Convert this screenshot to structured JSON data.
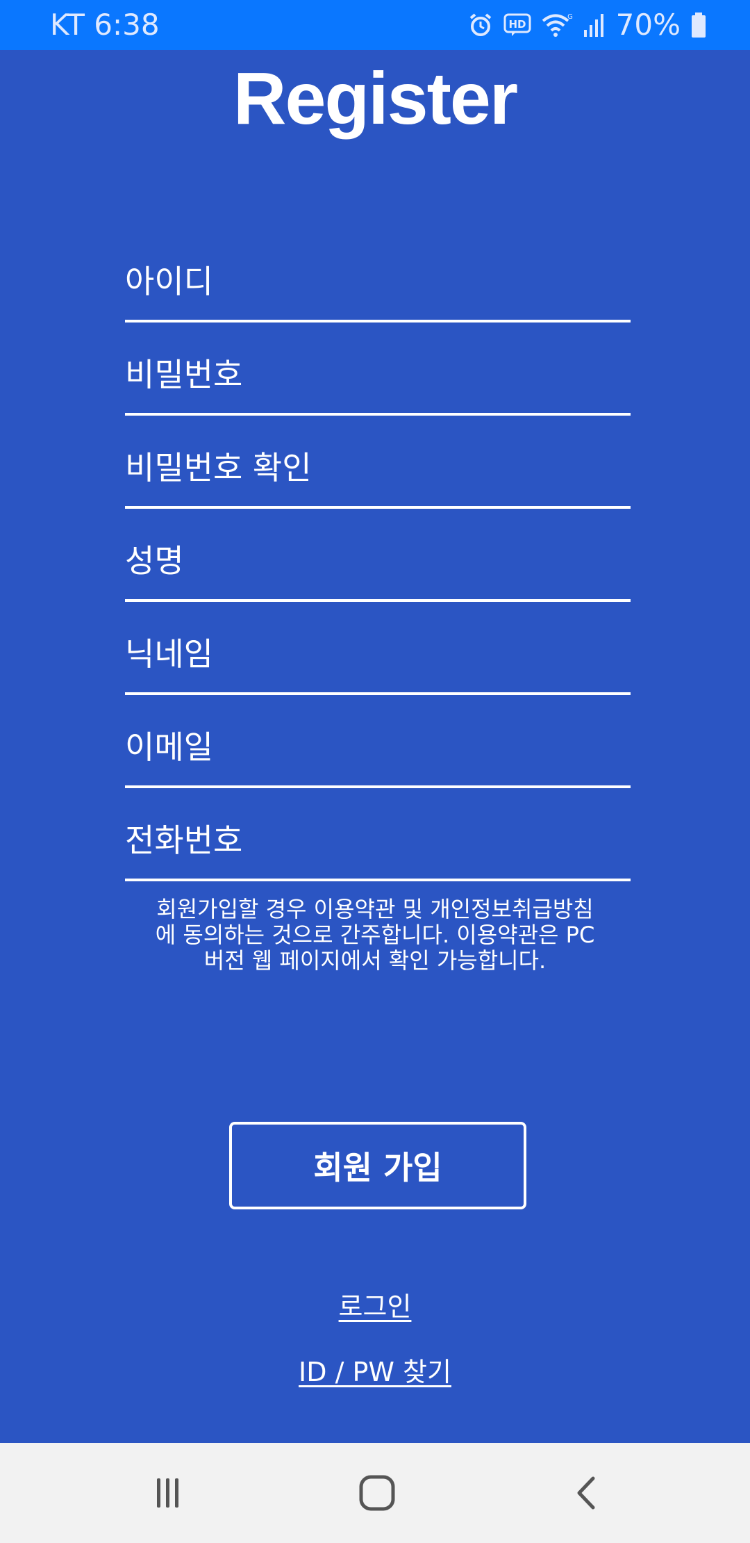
{
  "status_bar": {
    "carrier_time": "KT 6:38",
    "battery_percent": "70%",
    "icons": [
      "alarm-icon",
      "hd-icon",
      "wifi-icon",
      "signal-icon",
      "battery-icon"
    ]
  },
  "page": {
    "title": "Register"
  },
  "form": {
    "fields": [
      {
        "placeholder": "아이디"
      },
      {
        "placeholder": "비밀번호"
      },
      {
        "placeholder": "비밀번호 확인"
      },
      {
        "placeholder": "성명"
      },
      {
        "placeholder": "닉네임"
      },
      {
        "placeholder": "이메일"
      },
      {
        "placeholder": "전화번호"
      }
    ],
    "notice_lines": [
      "회원가입할 경우 이용약관 및 개인정보취급방침",
      "에 동의하는 것으로 간주합니다. 이용약관은 PC",
      "버전 웹 페이지에서 확인 가능합니다."
    ],
    "submit_label": "회원 가입"
  },
  "links": {
    "login": "로그인",
    "find_account": "ID / PW 찾기"
  },
  "nav_bar": {
    "icons": [
      "recent-apps-icon",
      "home-icon",
      "back-icon"
    ]
  },
  "colors": {
    "background": "#2b55c3",
    "status_bar": "#0a77ff",
    "nav_bar": "#f2f2f2",
    "text": "#ffffff"
  }
}
